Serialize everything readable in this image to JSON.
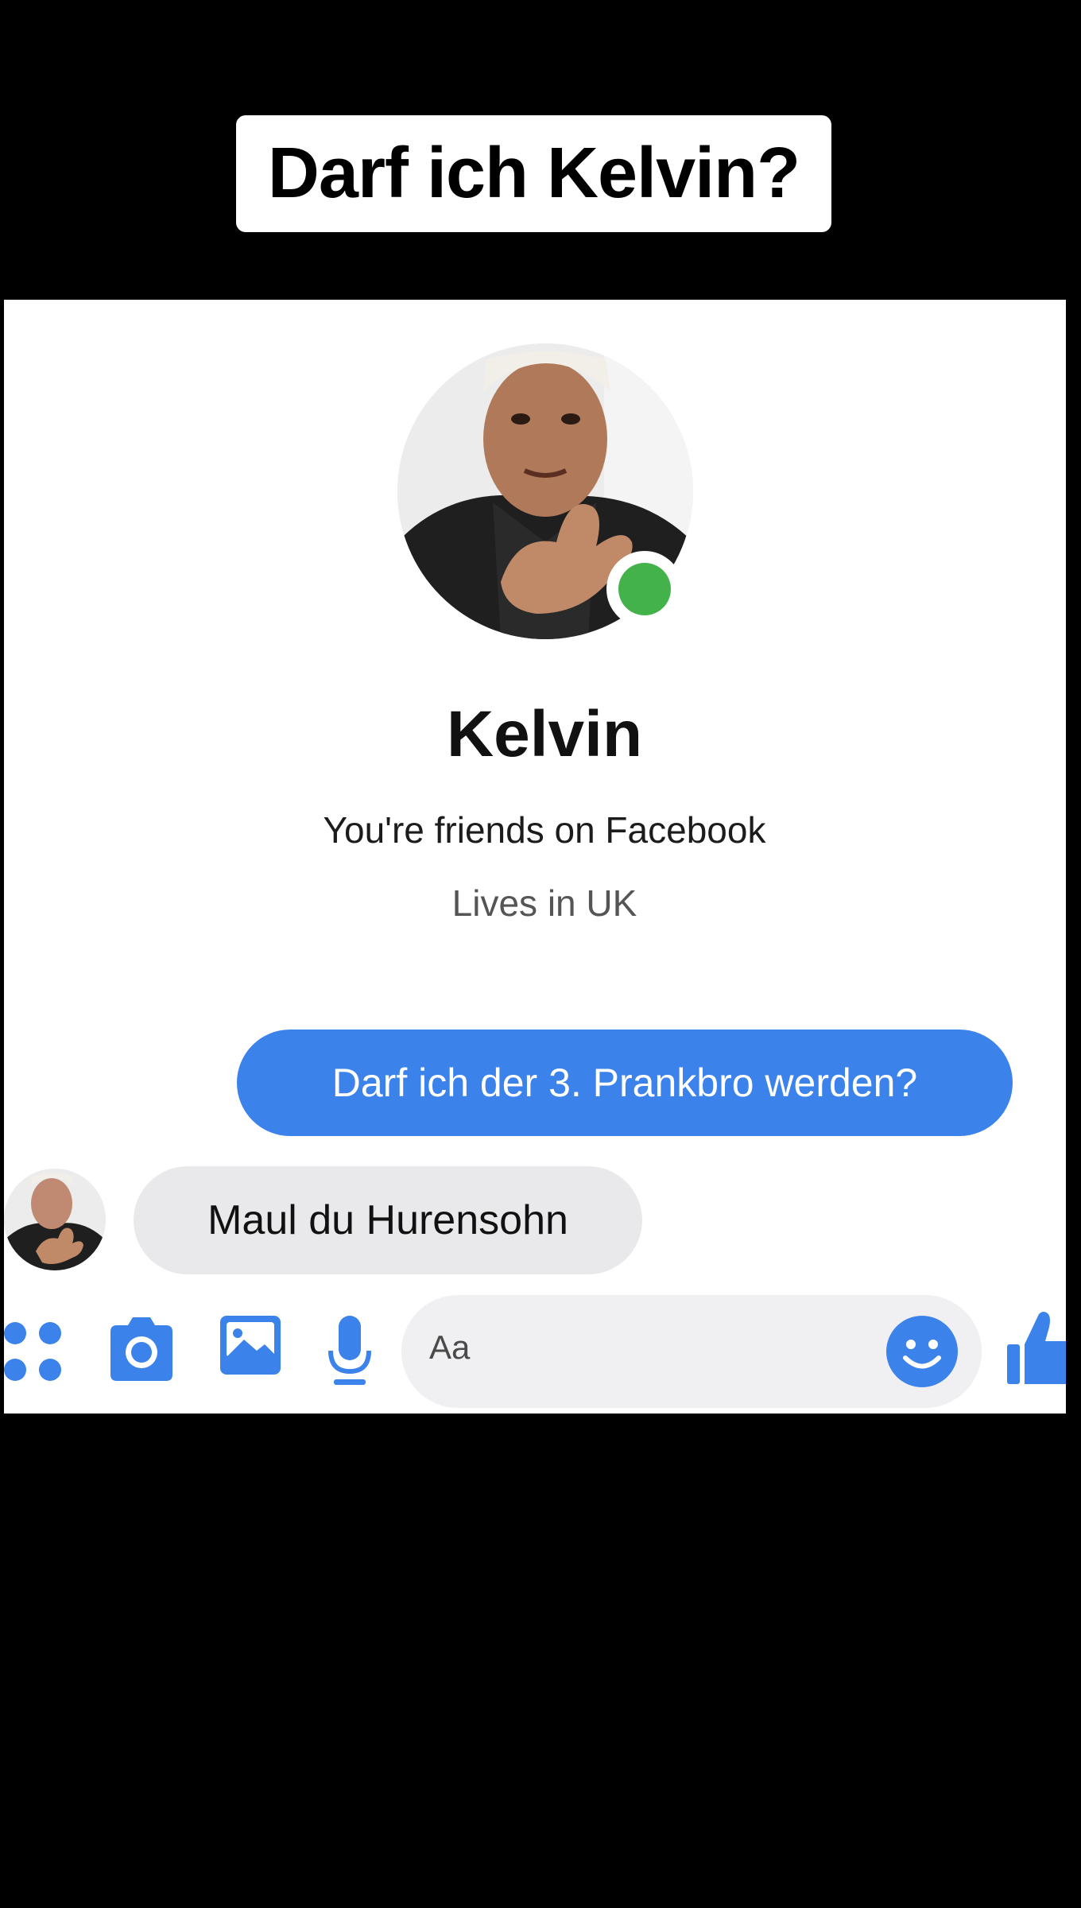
{
  "overlay": {
    "caption": "Darf ich Kelvin?"
  },
  "profile": {
    "name": "Kelvin",
    "relation": "You're friends on Facebook",
    "location": "Lives in UK",
    "online": true
  },
  "messages": [
    {
      "direction": "outgoing",
      "text": "Darf ich der 3. Prankbro werden?"
    },
    {
      "direction": "incoming",
      "text": "Maul du Hurensohn"
    }
  ],
  "composer": {
    "placeholder": "Aa",
    "icons": [
      "apps-icon",
      "camera-icon",
      "gallery-icon",
      "microphone-icon",
      "emoji-icon",
      "thumbs-up-icon"
    ]
  },
  "colors": {
    "accent": "#3b82ea",
    "online": "#44b24a",
    "incoming_bubble": "#e9e9eb"
  }
}
